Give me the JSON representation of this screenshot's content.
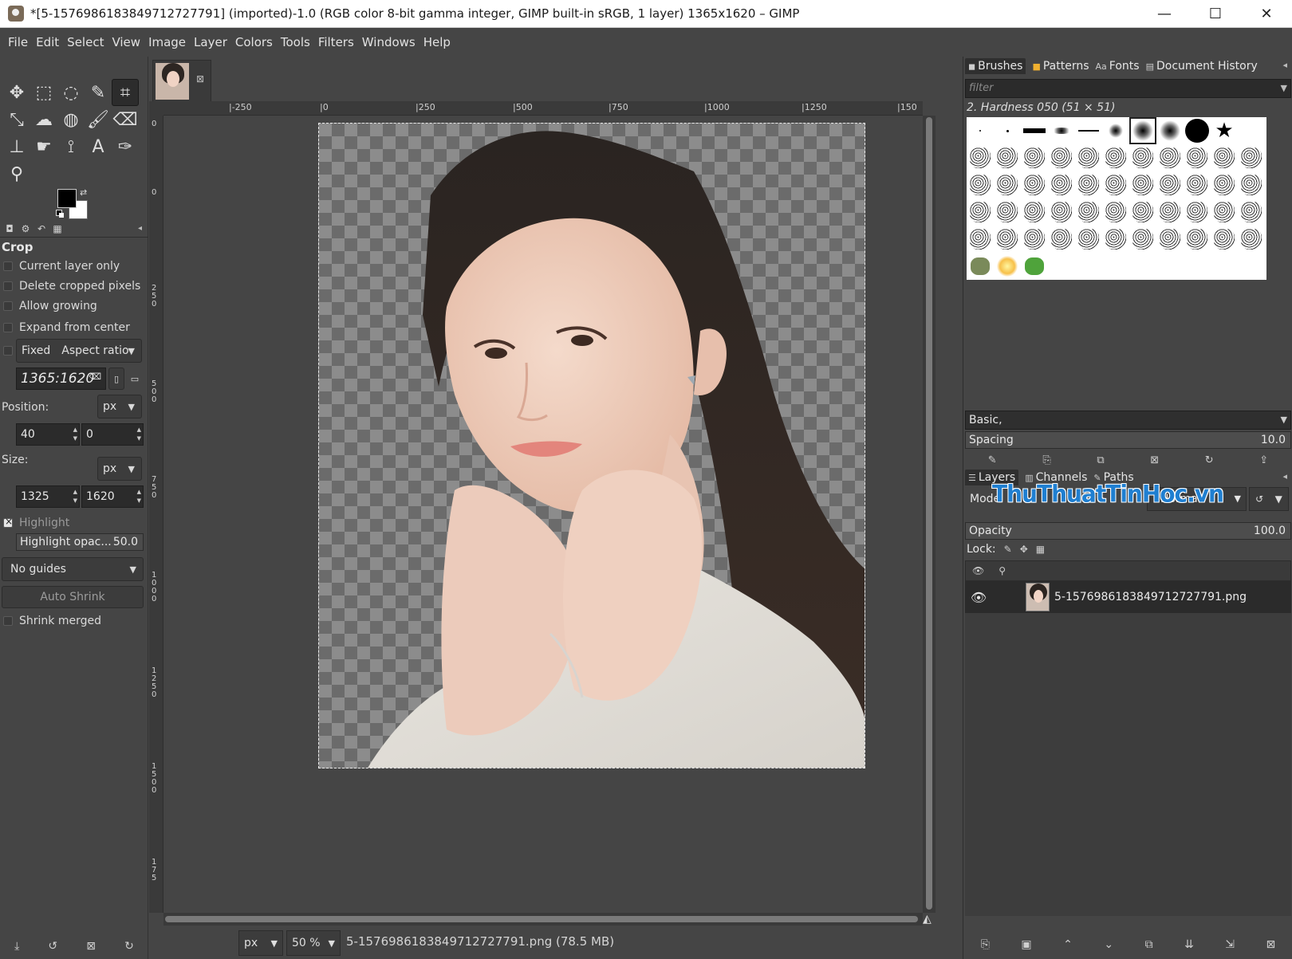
{
  "window": {
    "title": "*[5-1576986183849712727791] (imported)-1.0 (RGB color 8-bit gamma integer, GIMP built-in sRGB, 1 layer) 1365x1620 – GIMP",
    "minimize": "—",
    "maximize": "☐",
    "close": "✕"
  },
  "menubar": [
    "File",
    "Edit",
    "Select",
    "View",
    "Image",
    "Layer",
    "Colors",
    "Tools",
    "Filters",
    "Windows",
    "Help"
  ],
  "toolbox": {
    "tools": [
      {
        "name": "move-tool-icon",
        "glyph": "✥"
      },
      {
        "name": "rect-select-tool-icon",
        "glyph": "⬚"
      },
      {
        "name": "lasso-tool-icon",
        "glyph": "◌"
      },
      {
        "name": "fuzzy-select-tool-icon",
        "glyph": "✎"
      },
      {
        "name": "crop-tool-icon",
        "glyph": "⌗",
        "active": true
      },
      {
        "name": "transform-tool-icon",
        "glyph": "⤡"
      },
      {
        "name": "warp-tool-icon",
        "glyph": "☁"
      },
      {
        "name": "bucket-fill-tool-icon",
        "glyph": "◍"
      },
      {
        "name": "paintbrush-tool-icon",
        "glyph": "🖌"
      },
      {
        "name": "eraser-tool-icon",
        "glyph": "⌫"
      },
      {
        "name": "clone-tool-icon",
        "glyph": "⊥"
      },
      {
        "name": "smudge-tool-icon",
        "glyph": "☛"
      },
      {
        "name": "paths-tool-icon",
        "glyph": "⟟"
      },
      {
        "name": "text-tool-icon",
        "glyph": "A"
      },
      {
        "name": "color-picker-tool-icon",
        "glyph": "✑"
      },
      {
        "name": "zoom-tool-icon",
        "glyph": "⚲"
      }
    ],
    "options_tabs": [
      "◘",
      "⚙",
      "↶",
      "▦"
    ],
    "crop": {
      "title": "Crop",
      "current_layer_only": "Current layer only",
      "delete_cropped_pixels": "Delete cropped pixels",
      "allow_growing": "Allow growing",
      "expand_from_center": "Expand from center",
      "fixed_label": "Fixed",
      "fixed_mode": "Aspect ratio",
      "ratio_value": "1365:1620",
      "position_label": "Position:",
      "position_unit": "px",
      "position_x": "40",
      "position_y": "0",
      "size_label": "Size:",
      "size_unit": "px",
      "size_w": "1325",
      "size_h": "1620",
      "highlight": "Highlight",
      "highlight_opacity_label": "Highlight opac...",
      "highlight_opacity_value": "50.0",
      "guides": "No guides",
      "auto_shrink": "Auto Shrink",
      "shrink_merged": "Shrink merged"
    },
    "bottom_icons": [
      "⤓",
      "↺",
      "⊠",
      "↻"
    ]
  },
  "image": {
    "ruler_h_labels": [
      "|-250",
      "|0",
      "|250",
      "|500",
      "|750",
      "|1000",
      "|1250",
      "|150"
    ],
    "ruler_v_labels": [
      "0",
      "0",
      "250",
      "500",
      "750",
      "1000",
      "1250",
      "1500",
      "175"
    ],
    "unit": "px",
    "zoom": "50 %",
    "status": "5-1576986183849712727791.png (78.5 MB)"
  },
  "brushes_dock": {
    "tabs": [
      {
        "icon": "◼",
        "label": "Brushes"
      },
      {
        "icon": "■",
        "label": "Patterns"
      },
      {
        "icon": "Aa",
        "label": "Fonts"
      },
      {
        "icon": "▤",
        "label": "Document History"
      }
    ],
    "filter_placeholder": "filter",
    "brush_name": "2. Hardness 050 (51 × 51)",
    "tags": "Basic,",
    "spacing_label": "Spacing",
    "spacing_value": "10.0",
    "buttons": [
      "✎",
      "⎘",
      "⧉",
      "⊠",
      "↻",
      "⇪"
    ]
  },
  "layers_dock": {
    "tabs": [
      {
        "icon": "☰",
        "label": "Layers"
      },
      {
        "icon": "▥",
        "label": "Channels"
      },
      {
        "icon": "✎",
        "label": "Paths"
      }
    ],
    "mode_label": "Mode",
    "mode_value": "Normal",
    "watermark": "ThuThuatTinHoc.vn",
    "opacity_label": "Opacity",
    "opacity_value": "100.0",
    "lock_label": "Lock:",
    "layer_name": "5-1576986183849712727791.png",
    "bottom_buttons": [
      "⎘",
      "▣",
      "⌃",
      "⌄",
      "⧉",
      "⇊",
      "⇲",
      "⊠"
    ]
  },
  "colors": {
    "fg": "#000000",
    "bg": "#ffffff"
  }
}
